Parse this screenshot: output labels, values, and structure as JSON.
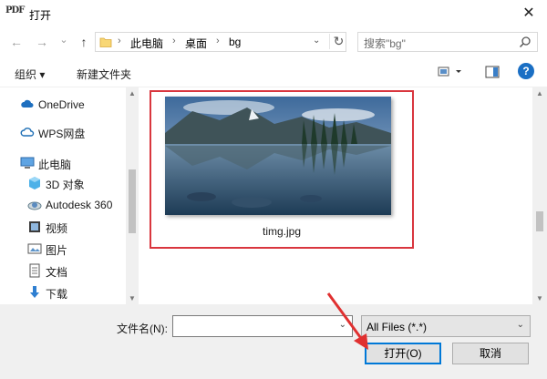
{
  "window": {
    "app_icon_text": "PDF",
    "title": "打开",
    "close_glyph": "✕"
  },
  "nav": {
    "back_glyph": "←",
    "forward_glyph": "→",
    "history_glyph": "⌄",
    "up_glyph": "↑"
  },
  "address": {
    "crumbs": [
      "此电脑",
      "桌面",
      "bg"
    ],
    "separator": "›",
    "dropdown_glyph": "⌄",
    "refresh_glyph": "↻"
  },
  "search": {
    "placeholder": "搜索\"bg\""
  },
  "toolbar": {
    "organize_label": "组织 ▾",
    "new_folder_label": "新建文件夹",
    "help_glyph": "?"
  },
  "sidebar": {
    "items": [
      {
        "label": "OneDrive",
        "icon": "cloud-icon"
      },
      {
        "label": "WPS网盘",
        "icon": "wps-cloud-icon"
      },
      {
        "label": "此电脑",
        "icon": "computer-icon"
      },
      {
        "label": "3D 对象",
        "icon": "cube-icon"
      },
      {
        "label": "Autodesk 360",
        "icon": "autodesk-icon"
      },
      {
        "label": "视频",
        "icon": "video-icon"
      },
      {
        "label": "图片",
        "icon": "picture-icon"
      },
      {
        "label": "文档",
        "icon": "document-icon"
      },
      {
        "label": "下载",
        "icon": "download-icon"
      }
    ]
  },
  "files": [
    {
      "name": "timg.jpg",
      "selected": true
    }
  ],
  "footer": {
    "filename_label": "文件名(N):",
    "filename_value": "",
    "filter_value": "All Files (*.*)",
    "dropdown_glyph": "⌄",
    "open_label": "打开(O)",
    "cancel_label": "取消"
  },
  "colors": {
    "accent": "#0078d7",
    "highlight_box": "#d9363e",
    "annotation_arrow": "#e03030"
  }
}
